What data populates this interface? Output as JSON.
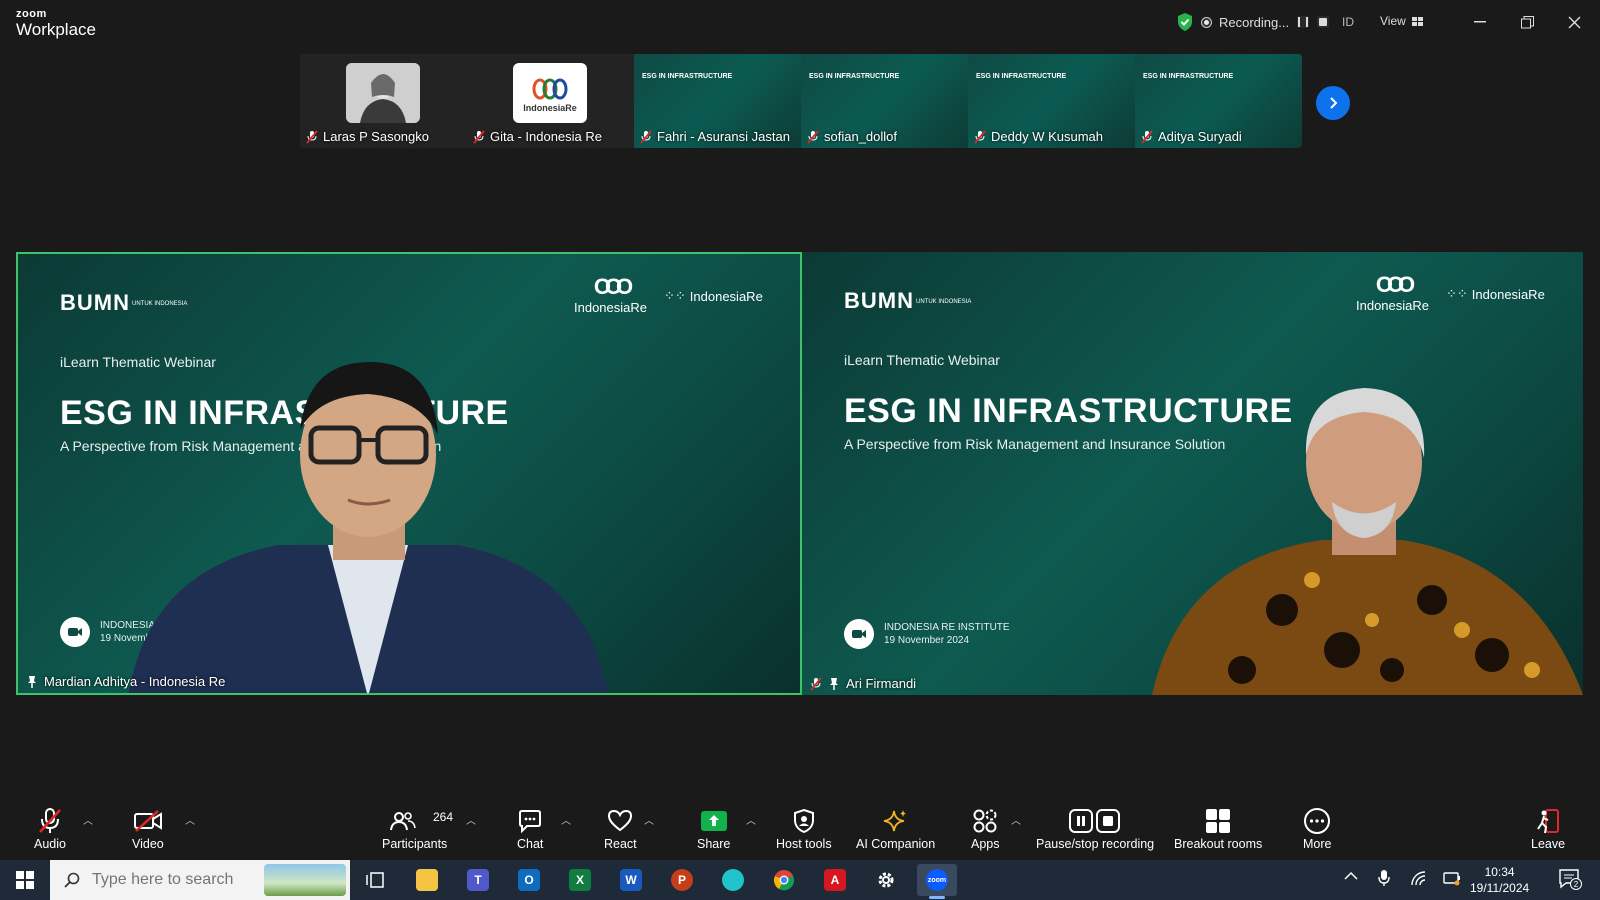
{
  "app": {
    "brand_top": "zoom",
    "brand_name": "Workplace"
  },
  "titlebar": {
    "recording_label": "Recording...",
    "language": "ID",
    "view_label": "View"
  },
  "thumbnails": [
    {
      "name": "Laras P Sasongko",
      "kind": "photo"
    },
    {
      "name": "Gita - Indonesia Re",
      "kind": "logo",
      "logo_text": "IndonesiaRe"
    },
    {
      "name": "Fahri - Asuransi Jastan",
      "kind": "slide"
    },
    {
      "name": "sofian_dollof",
      "kind": "slide"
    },
    {
      "name": "Deddy W Kusumah",
      "kind": "slide"
    },
    {
      "name": "Aditya Suryadi",
      "kind": "slide"
    }
  ],
  "slide_mini": {
    "title": "ESG IN INFRASTRUCTURE"
  },
  "slide": {
    "bumn": "BUMN",
    "bumn_small": "UNTUK INDONESIA",
    "ire": "IndonesiaRe",
    "institute": "IndonesiaRe",
    "kicker": "iLearn Thematic Webinar",
    "title": "ESG IN INFRASTRUCTURE",
    "subtitle": "A Perspective from Risk Management and Insurance Solution",
    "event_org": "INDONESIA RE INSTITUTE",
    "event_date": "19 November 2024"
  },
  "videos": [
    {
      "name": "Mardian Adhitya - Indonesia Re",
      "speaking": true
    },
    {
      "name": "Ari Firmandi",
      "speaking": false
    }
  ],
  "toolbar": {
    "audio": "Audio",
    "video": "Video",
    "participants": "Participants",
    "participants_count": "264",
    "chat": "Chat",
    "react": "React",
    "share": "Share",
    "host_tools": "Host tools",
    "ai_companion": "AI Companion",
    "apps": "Apps",
    "pause_stop_recording": "Pause/stop recording",
    "breakout_rooms": "Breakout rooms",
    "more": "More",
    "leave": "Leave"
  },
  "taskbar": {
    "search_placeholder": "Type here to search",
    "time": "10:34",
    "date": "19/11/2024",
    "notif_count": "2"
  },
  "colors": {
    "accent": "#0e72ed",
    "speaker_border": "#3ec36b",
    "leave": "#e02828",
    "share": "#12b14b"
  }
}
